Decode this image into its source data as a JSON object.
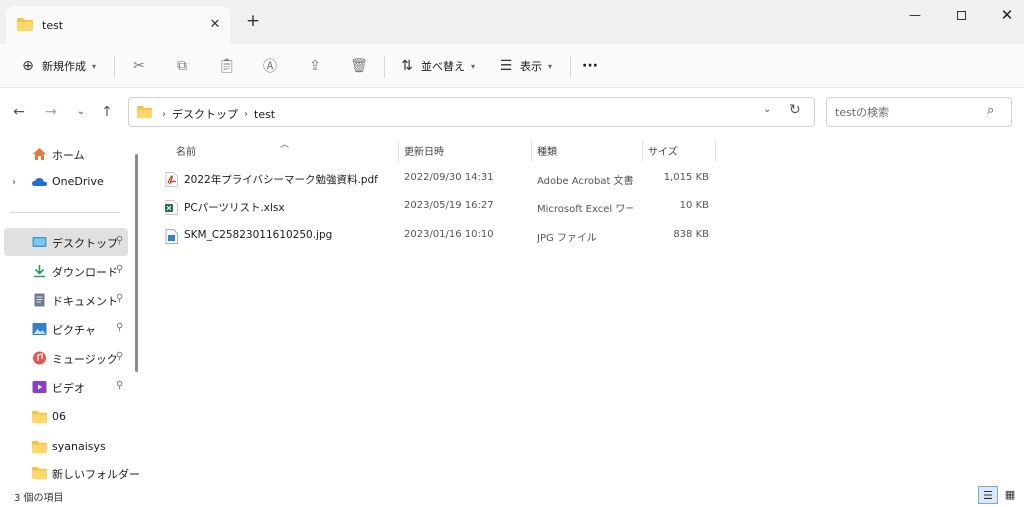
{
  "window": {
    "tab_title": "test",
    "tab_close": "✕",
    "new_tab": "+",
    "min": "—",
    "close": "✕"
  },
  "toolbar": {
    "new_label": "新規作成",
    "sort_label": "並べ替え",
    "view_label": "表示",
    "more": "···",
    "caret": "⌄"
  },
  "address": {
    "crumbs": [
      "デスクトップ",
      "test"
    ],
    "chevron": "›"
  },
  "search": {
    "placeholder": "testの検索"
  },
  "sidebar": {
    "items": [
      {
        "label": "ホーム",
        "icon": "home-icon"
      },
      {
        "label": "OneDrive",
        "icon": "cloud-icon"
      },
      {
        "label": "デスクトップ",
        "icon": "desktop-icon",
        "selected": true
      },
      {
        "label": "ダウンロード",
        "icon": "download-icon"
      },
      {
        "label": "ドキュメント",
        "icon": "document-icon"
      },
      {
        "label": "ピクチャ",
        "icon": "picture-icon"
      },
      {
        "label": "ミュージック",
        "icon": "music-icon"
      },
      {
        "label": "ビデオ",
        "icon": "video-icon"
      },
      {
        "label": "06",
        "icon": "folder-icon"
      },
      {
        "label": "syanaisys",
        "icon": "folder-icon"
      },
      {
        "label": "新しいフォルダー",
        "icon": "folder-icon"
      }
    ]
  },
  "columns": {
    "name": "名前",
    "date": "更新日時",
    "type": "種類",
    "size": "サイズ"
  },
  "files": [
    {
      "name": "2022年プライバシーマーク勉強資料.pdf",
      "date": "2022/09/30 14:31",
      "type": "Adobe Acrobat 文書",
      "size": "1,015 KB",
      "icon": "pdf-file-icon"
    },
    {
      "name": "PCパーツリスト.xlsx",
      "date": "2023/05/19 16:27",
      "type": "Microsoft Excel ワークシート",
      "size": "10 KB",
      "icon": "excel-file-icon"
    },
    {
      "name": "SKM_C25823011610250.jpg",
      "date": "2023/01/16 10:10",
      "type": "JPG ファイル",
      "size": "838 KB",
      "icon": "image-file-icon"
    }
  ],
  "status": {
    "item_count": "3 個の項目"
  },
  "colors": {
    "folder": "#f4c542",
    "selected": "#e0e0e0",
    "accent": "#0067c0"
  }
}
